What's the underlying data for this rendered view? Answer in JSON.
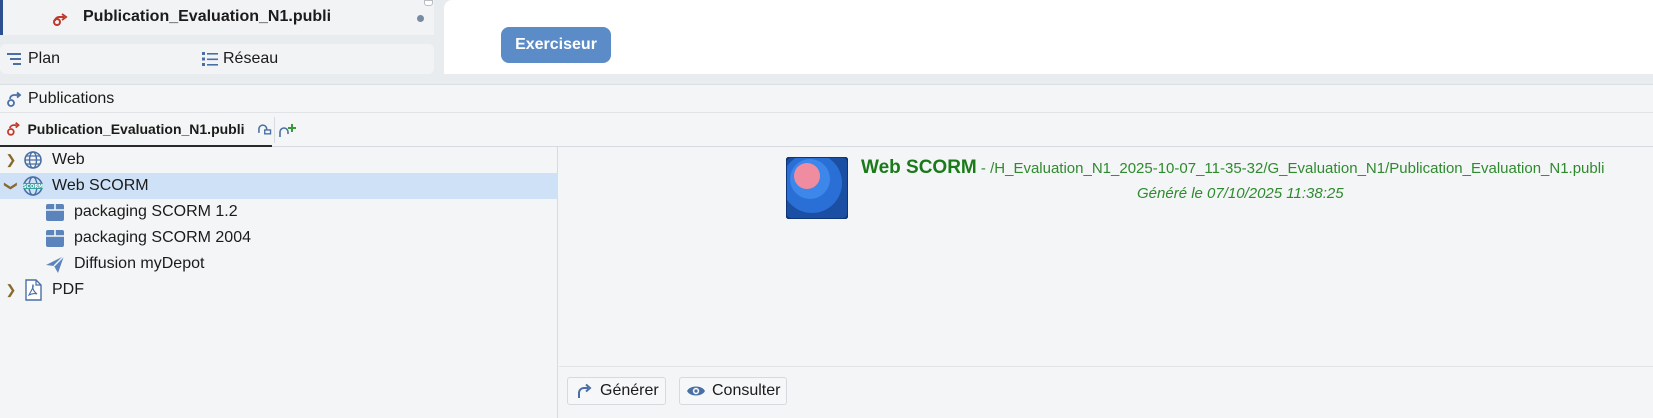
{
  "top": {
    "file_name": "Publication_Evaluation_N1.publi",
    "plan_label": "Plan",
    "reseau_label": "Réseau",
    "exerciseur_label": "Exerciseur"
  },
  "publications": {
    "header_label": "Publications",
    "tab_label": "Publication_Evaluation_N1.publi",
    "tree": [
      {
        "label": "Web",
        "expanded": false,
        "icon": "globe-icon"
      },
      {
        "label": "Web SCORM",
        "expanded": true,
        "selected": true,
        "icon": "scorm-globe-icon"
      },
      {
        "label": "packaging SCORM 1.2",
        "icon": "package-icon"
      },
      {
        "label": "packaging SCORM 2004",
        "icon": "package-icon"
      },
      {
        "label": "Diffusion myDepot",
        "icon": "paper-plane-icon"
      },
      {
        "label": "PDF",
        "expanded": false,
        "icon": "pdf-icon"
      }
    ],
    "detail": {
      "title": "Web SCORM",
      "path": " - /H_Evaluation_N1_2025-10-07_11-35-32/G_Evaluation_N1/Publication_Evaluation_N1.publi",
      "generated": "Généré le 07/10/2025 11:38:25",
      "generate_label": "Générer",
      "consult_label": "Consulter"
    }
  },
  "colors": {
    "accent": "#5b8cc7",
    "selection": "#cfe1f7",
    "success_text": "#1a7a1a"
  }
}
